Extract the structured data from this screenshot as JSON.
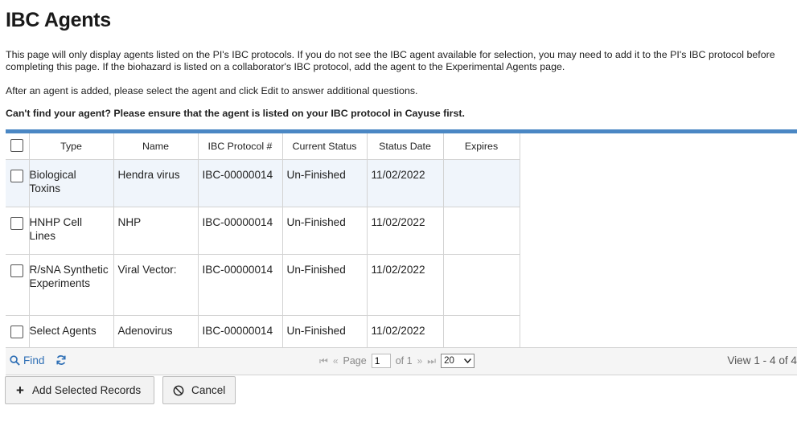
{
  "page": {
    "title": "IBC Agents",
    "paragraph1": "This page will only display agents listed on the PI's IBC protocols. If you do not see the IBC agent available for selection, you may need to add it to the PI's IBC protocol before completing this page. If the biohazard is listed on a collaborator's IBC protocol, add the agent to the Experimental Agents page.",
    "paragraph2": "After an agent is added, please select the agent and click Edit to answer additional questions.",
    "paragraph3": "Can't find your agent? Please ensure that the agent is listed on your IBC protocol in Cayuse first."
  },
  "grid": {
    "columns": [
      "Type",
      "Name",
      "IBC Protocol #",
      "Current Status",
      "Status Date",
      "Expires"
    ],
    "rows": [
      {
        "type": "Biological Toxins",
        "name": "Hendra virus",
        "protocol": "IBC-00000014",
        "status": "Un-Finished",
        "date": "11/02/2022",
        "expires": ""
      },
      {
        "type": "HNHP Cell Lines",
        "name": "NHP",
        "protocol": "IBC-00000014",
        "status": "Un-Finished",
        "date": "11/02/2022",
        "expires": ""
      },
      {
        "type": "R/sNA Synthetic Experiments",
        "name": "Viral Vector:",
        "protocol": "IBC-00000014",
        "status": "Un-Finished",
        "date": "11/02/2022",
        "expires": ""
      },
      {
        "type": "Select Agents",
        "name": "Adenovirus",
        "protocol": "IBC-00000014",
        "status": "Un-Finished",
        "date": "11/02/2022",
        "expires": ""
      }
    ]
  },
  "pager": {
    "find_label": "Find",
    "page_label": "Page",
    "page_value": "1",
    "of_label": "of 1",
    "page_size": "20",
    "view_info": "View 1 - 4 of 4"
  },
  "buttons": {
    "add_label": "Add Selected Records",
    "cancel_label": "Cancel"
  },
  "icons": {
    "search": "search-icon",
    "refresh": "refresh-icon",
    "first": "first-page-icon",
    "prev": "prev-page-icon",
    "next": "next-page-icon",
    "last": "last-page-icon",
    "plus": "plus-icon",
    "cancel": "cancel-icon"
  },
  "colors": {
    "accent": "#4a87c4",
    "link": "#2f6fb5",
    "selected_row": "#f0f5fb"
  }
}
